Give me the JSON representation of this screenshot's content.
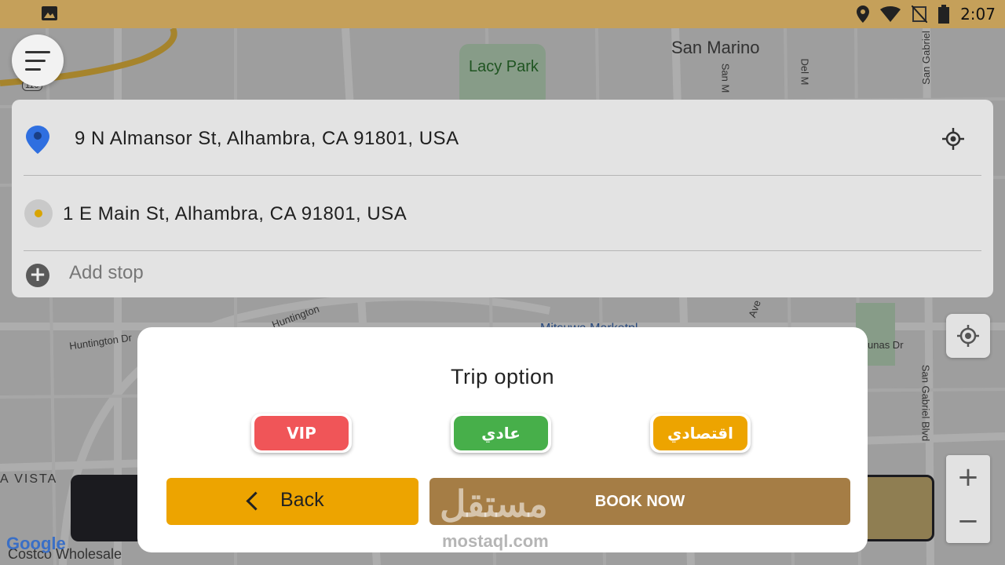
{
  "status_bar": {
    "time": "2:07",
    "icons": [
      "image-icon",
      "location-icon",
      "wifi-icon",
      "no-signal-icon",
      "battery-icon"
    ]
  },
  "map": {
    "labels": {
      "san_marino": "San Marino",
      "lacy_park": "Lacy Park",
      "huntington": "Huntington Dr",
      "huntington2": "Huntington",
      "vista": "A VISTA",
      "costco": "Costco Wholesale",
      "san_gabriel": "San Gabriel Blvd",
      "lunas_dr": "unas Dr",
      "del_m": "Del M",
      "san_m": "San M",
      "san_gab_top": "San Gabriel",
      "ave": "Ave",
      "mitsuwa": "Mitsuwa Marketpl",
      "hwy": "110",
      "google": "Google"
    }
  },
  "search": {
    "pickup": "9 N Almansor St, Alhambra, CA 91801, USA",
    "destination": "1 E Main St, Alhambra, CA 91801, USA",
    "add_stop": "Add stop"
  },
  "zoom": {
    "plus": "+",
    "minus": "−"
  },
  "dialog": {
    "title": "Trip option",
    "options": [
      {
        "label": "VIP",
        "color": "#f05558"
      },
      {
        "label": "عادي",
        "color": "#47af4a"
      },
      {
        "label": "اقتصادي",
        "color": "#eda400"
      }
    ],
    "back_label": "Back",
    "book_label": "BOOK NOW"
  },
  "colors": {
    "status_bar": "#c5a05a",
    "accent_gold": "#eda400",
    "book_brown": "#a57d45"
  },
  "watermark": {
    "arabic": "مستقل",
    "latin": "mostaql.com"
  }
}
